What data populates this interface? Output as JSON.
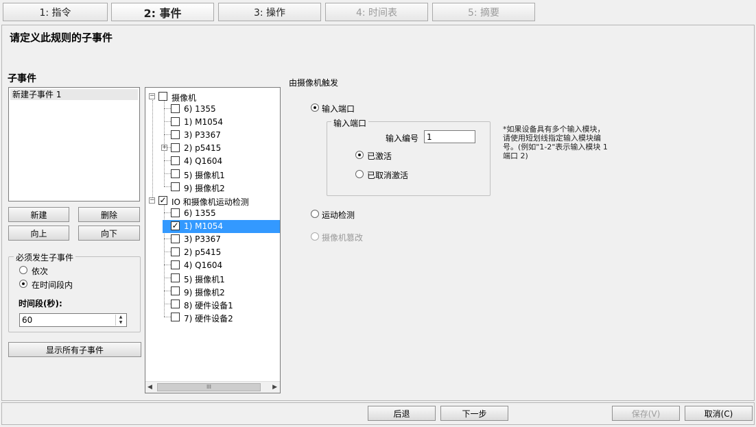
{
  "wizard_tabs": [
    {
      "label": "1: 指令"
    },
    {
      "label": "2: 事件"
    },
    {
      "label": "3: 操作"
    },
    {
      "label": "4: 时间表"
    },
    {
      "label": "5: 摘要"
    }
  ],
  "page_title": "请定义此规则的子事件",
  "subevents": {
    "heading": "子事件",
    "items": [
      "新建子事件 1"
    ],
    "buttons": {
      "new": "新建",
      "delete": "删除",
      "up": "向上",
      "down": "向下"
    },
    "must_occur": {
      "title": "必须发生子事件",
      "option_sequential": "依次",
      "option_within": "在时间段内",
      "selected": "在时间段内",
      "period_label": "时间段(秒):",
      "period_value": "60"
    },
    "show_all_button": "显示所有子事件"
  },
  "tree": {
    "groups": [
      {
        "label": "摄像机",
        "checked": false,
        "children": [
          {
            "label": "6) 1355",
            "checked": false
          },
          {
            "label": "1) M1054",
            "checked": false
          },
          {
            "label": "3) P3367",
            "checked": false
          },
          {
            "label": "2) p5415",
            "checked": false,
            "expandable": true
          },
          {
            "label": "4) Q1604",
            "checked": false
          },
          {
            "label": "5) 摄像机1",
            "checked": false
          },
          {
            "label": "9) 摄像机2",
            "checked": false
          }
        ]
      },
      {
        "label": "IO 和摄像机运动检测",
        "checked": true,
        "children": [
          {
            "label": "6) 1355",
            "checked": false
          },
          {
            "label": "1) M1054",
            "checked": true,
            "selected": true
          },
          {
            "label": "3) P3367",
            "checked": false
          },
          {
            "label": "2) p5415",
            "checked": false
          },
          {
            "label": "4) Q1604",
            "checked": false
          },
          {
            "label": "5) 摄像机1",
            "checked": false
          },
          {
            "label": "9) 摄像机2",
            "checked": false
          },
          {
            "label": "8) 硬件设备1",
            "checked": false
          },
          {
            "label": "7) 硬件设备2",
            "checked": false
          }
        ]
      }
    ],
    "scrollbar_thumb_glyph": "III"
  },
  "trigger": {
    "heading": "由摄像机触发",
    "option_input_port": "输入端口",
    "input_port_group_title": "输入端口",
    "input_number_label": "输入编号",
    "input_number_value": "1",
    "option_activated": "已激活",
    "option_deactivated": "已取消激活",
    "note": "*如果设备具有多个输入模块，请使用短划线指定输入模块编号。(例如\"1-2\"表示输入模块 1 端口 2)",
    "option_motion": "运动检测",
    "option_tamper": "摄像机篡改",
    "selected_source": "输入端口",
    "selected_state": "已激活"
  },
  "footer": {
    "back": "后退",
    "next": "下一步",
    "save": "保存(V)",
    "cancel": "取消(C)"
  },
  "colors": {
    "selection": "#3399ff",
    "window_bg": "#f0f0f0",
    "disabled_text": "#9a9a9a"
  },
  "icons": [
    "tree-expander-icon",
    "checkbox-icon",
    "radio-icon",
    "spinner-arrows-icon",
    "scroll-left-icon",
    "scroll-right-icon"
  ]
}
